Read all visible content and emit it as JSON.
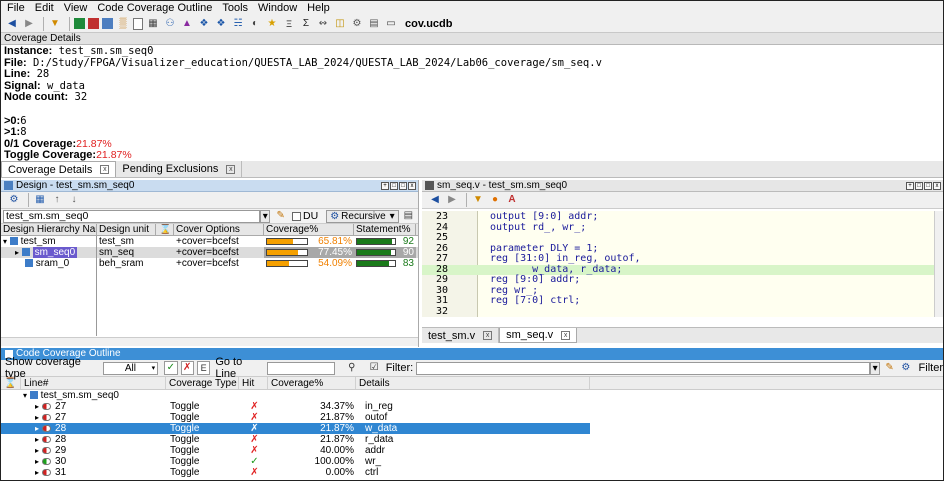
{
  "menubar": [
    "File",
    "Edit",
    "View",
    "Code Coverage Outline",
    "Tools",
    "Window",
    "Help"
  ],
  "toolbar": {
    "db_name": "cov.ucdb"
  },
  "details": {
    "title": "Coverage Details",
    "instance_label": "Instance:",
    "instance": "test_sm.sm_seq0",
    "file_label": "File:",
    "file": "D:/Study/FPGA/Visualizer_education/QUESTA_LAB_2024/QUESTA_LAB_2024/Lab06_coverage/sm_seq.v",
    "line_label": "Line:",
    "line": "28",
    "signal_label": "Signal:",
    "signal": "w_data",
    "nodecount_label": "Node count:",
    "nodecount": "32",
    "to0_label": ">0:",
    "to0": "6",
    "to1_label": ">1:",
    "to1": "8",
    "cov01_label": "0/1 Coverage:",
    "cov01": "21.87%",
    "toggle_label": "Toggle Coverage:",
    "toggle": "21.87%"
  },
  "tabs_top": [
    "Coverage Details",
    "Pending Exclusions"
  ],
  "design": {
    "title": "Design - test_sm.sm_seq0",
    "path": "test_sm.sm_seq0",
    "du_label": "DU",
    "recursive_label": "Recursive",
    "columns": [
      "Design Hierarchy Name",
      "Design unit",
      "",
      "Cover Options",
      "Coverage%",
      "Statement%"
    ],
    "rows": [
      {
        "name": "test_sm",
        "unit": "test_sm",
        "options": "+cover=bcefst",
        "coverage": "65.81%",
        "cov_frac": 0.6581,
        "stmt": "92",
        "stmt_frac": 0.92
      },
      {
        "name": "sm_seq0",
        "unit": "sm_seq",
        "options": "+cover=bcefst",
        "coverage": "77.45%",
        "cov_frac": 0.7745,
        "stmt": "90",
        "stmt_frac": 0.9
      },
      {
        "name": "sram_0",
        "unit": "beh_sram",
        "options": "+cover=bcefst",
        "coverage": "54.09%",
        "cov_frac": 0.5409,
        "stmt": "83",
        "stmt_frac": 0.83
      }
    ]
  },
  "source": {
    "title": "sm_seq.v - test_sm.sm_seq0",
    "lines": [
      {
        "n": "23",
        "t": "output [9:0] addr;"
      },
      {
        "n": "24",
        "t": "output rd_, wr_;"
      },
      {
        "n": "25",
        "t": ""
      },
      {
        "n": "26",
        "t": "parameter DLY = 1;"
      },
      {
        "n": "27",
        "t": "reg [31:0] in_reg, outof,"
      },
      {
        "n": "28",
        "t": "       w_data, r_data;"
      },
      {
        "n": "29",
        "t": "reg [9:0] addr;"
      },
      {
        "n": "30",
        "t": "reg wr_;"
      },
      {
        "n": "31",
        "t": "reg [7:0] ctrl;"
      },
      {
        "n": "32",
        "t": ""
      }
    ],
    "tabs": [
      "test_sm.v",
      "sm_seq.v"
    ]
  },
  "outline": {
    "title": "Code Coverage Outline",
    "show_label": "Show coverage type",
    "show_value": "All",
    "goto_label": "Go to Line",
    "filter_label": "Filter:",
    "filter_right_label": "Filter",
    "columns": [
      "Line#",
      "Coverage Type",
      "Hit",
      "Coverage%",
      "Details"
    ],
    "root": "test_sm.sm_seq0",
    "rows": [
      {
        "line": "27",
        "type": "Toggle",
        "hit": "✗",
        "ok": false,
        "cov": "34.37%",
        "detail": "in_reg"
      },
      {
        "line": "27",
        "type": "Toggle",
        "hit": "✗",
        "ok": false,
        "cov": "21.87%",
        "detail": "outof"
      },
      {
        "line": "28",
        "type": "Toggle",
        "hit": "✗",
        "ok": false,
        "cov": "21.87%",
        "detail": "w_data"
      },
      {
        "line": "28",
        "type": "Toggle",
        "hit": "✗",
        "ok": false,
        "cov": "21.87%",
        "detail": "r_data"
      },
      {
        "line": "29",
        "type": "Toggle",
        "hit": "✗",
        "ok": false,
        "cov": "40.00%",
        "detail": "addr"
      },
      {
        "line": "30",
        "type": "Toggle",
        "hit": "✓",
        "ok": true,
        "cov": "100.00%",
        "detail": "wr_"
      },
      {
        "line": "31",
        "type": "Toggle",
        "hit": "✗",
        "ok": false,
        "cov": "0.00%",
        "detail": "ctrl"
      }
    ]
  }
}
